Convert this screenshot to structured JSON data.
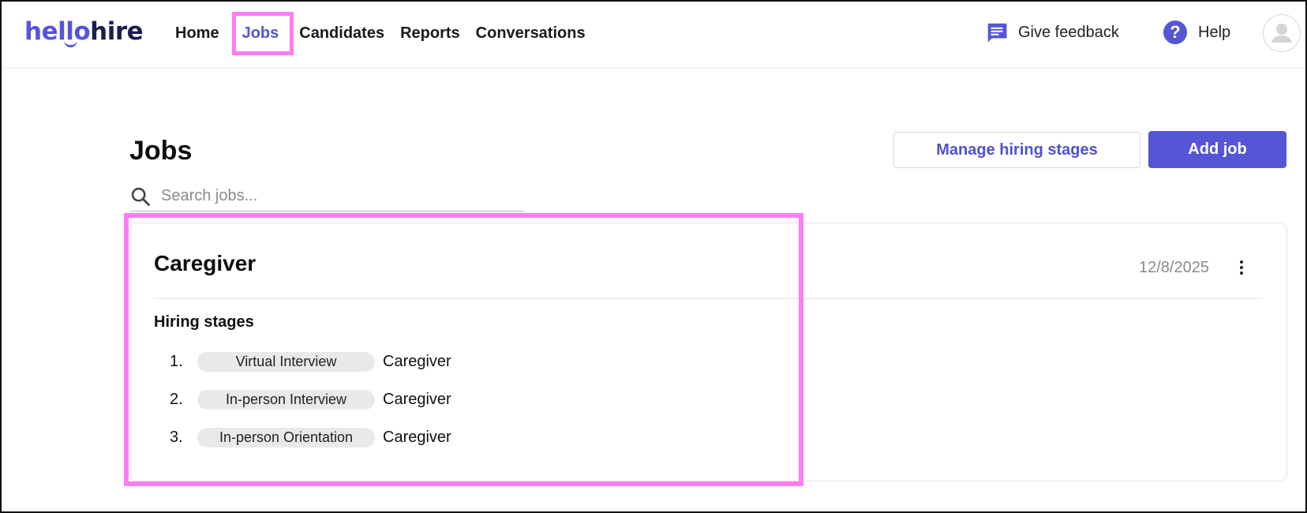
{
  "header": {
    "logo": {
      "hello": "hello",
      "hire": "hire"
    },
    "nav": [
      {
        "label": "Home",
        "active": false
      },
      {
        "label": "Jobs",
        "active": true
      },
      {
        "label": "Candidates",
        "active": false
      },
      {
        "label": "Reports",
        "active": false
      },
      {
        "label": "Conversations",
        "active": false
      }
    ],
    "feedback_label": "Give feedback",
    "help_label": "Help",
    "help_glyph": "?"
  },
  "page": {
    "title": "Jobs",
    "manage_button": "Manage hiring stages",
    "add_button": "Add job",
    "search": {
      "placeholder": "Search jobs...",
      "value": ""
    }
  },
  "jobs": [
    {
      "title": "Caregiver",
      "date": "12/8/2025",
      "stages_heading": "Hiring stages",
      "stages": [
        {
          "num": "1.",
          "stage": "Virtual Interview",
          "role": "Caregiver"
        },
        {
          "num": "2.",
          "stage": "In-person Interview",
          "role": "Caregiver"
        },
        {
          "num": "3.",
          "stage": "In-person Orientation",
          "role": "Caregiver"
        }
      ]
    }
  ],
  "colors": {
    "accent": "#5456d6",
    "logo_dark": "#1b1d4e",
    "highlight": "#ff7cf5",
    "pill_bg": "#e9e9e9"
  },
  "icons": [
    "feedback-icon",
    "help-icon",
    "avatar-icon",
    "search-icon",
    "more-vert-icon"
  ]
}
